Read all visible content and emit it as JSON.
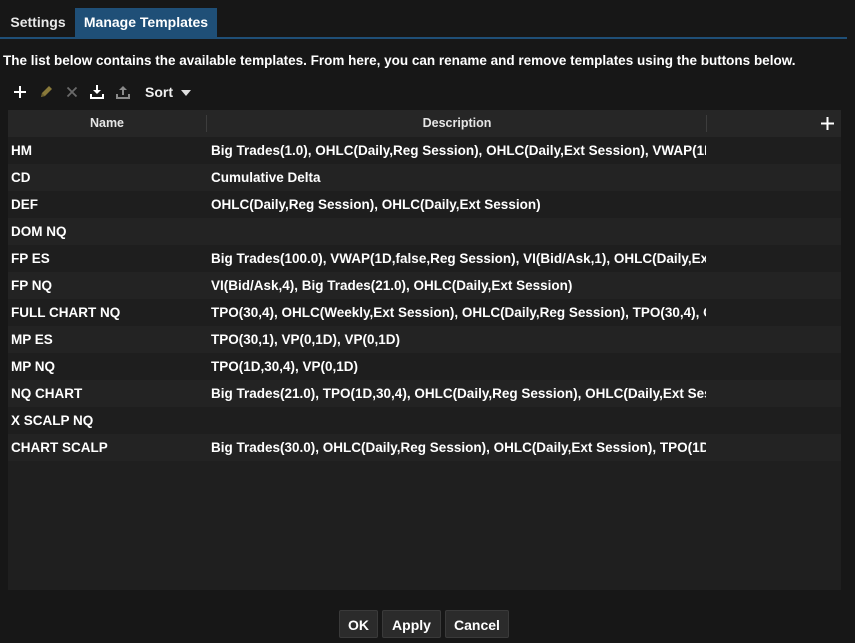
{
  "tabs": [
    {
      "label": "Settings",
      "active": false
    },
    {
      "label": "Manage Templates",
      "active": true
    }
  ],
  "intro_text": "The list below contains the available templates.  From here, you can rename and remove templates using the buttons below.",
  "toolbar": {
    "icons": [
      "plus-icon",
      "pencil-icon",
      "x-icon",
      "download-icon",
      "upload-icon"
    ],
    "sort_label": "Sort"
  },
  "table": {
    "columns": {
      "name": "Name",
      "description": "Description"
    },
    "rows": [
      {
        "name": "HM",
        "description": "Big Trades(1.0), OHLC(Daily,Reg Session), OHLC(Daily,Ext Session), VWAP(1D"
      },
      {
        "name": "CD",
        "description": "Cumulative Delta"
      },
      {
        "name": "DEF",
        "description": "OHLC(Daily,Reg Session), OHLC(Daily,Ext Session)"
      },
      {
        "name": "DOM NQ",
        "description": ""
      },
      {
        "name": "FP ES",
        "description": "Big Trades(100.0), VWAP(1D,false,Reg Session), VI(Bid/Ask,1), OHLC(Daily,Ex"
      },
      {
        "name": "FP NQ",
        "description": "VI(Bid/Ask,4), Big Trades(21.0), OHLC(Daily,Ext Session)"
      },
      {
        "name": "FULL CHART NQ",
        "description": "TPO(30,4), OHLC(Weekly,Ext Session), OHLC(Daily,Reg Session), TPO(30,4), O"
      },
      {
        "name": "MP ES",
        "description": "TPO(30,1), VP(0,1D), VP(0,1D)"
      },
      {
        "name": "MP NQ",
        "description": "TPO(1D,30,4), VP(0,1D)"
      },
      {
        "name": "NQ CHART",
        "description": "Big Trades(21.0), TPO(1D,30,4), OHLC(Daily,Reg Session), OHLC(Daily,Ext Ses"
      },
      {
        "name": "X SCALP NQ",
        "description": ""
      },
      {
        "name": "CHART SCALP",
        "description": "Big Trades(30.0), OHLC(Daily,Reg Session), OHLC(Daily,Ext Session), TPO(1D,"
      }
    ]
  },
  "buttons": {
    "ok": "OK",
    "apply": "Apply",
    "cancel": "Cancel"
  },
  "colors": {
    "background": "#171717",
    "accent": "#1f4f77",
    "text": "#ffffff"
  }
}
